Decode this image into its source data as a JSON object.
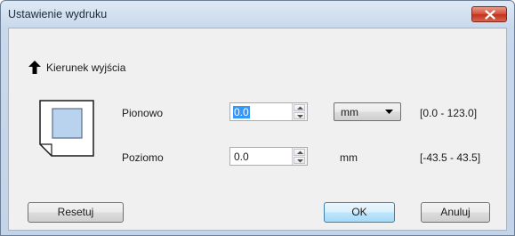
{
  "window": {
    "title": "Ustawienie wydruku"
  },
  "direction": {
    "label": "Kierunek wyjścia"
  },
  "vertical": {
    "label": "Pionowo",
    "value": "0.0",
    "unit": "mm",
    "range": "[0.0 - 123.0]"
  },
  "horizontal": {
    "label": "Poziomo",
    "value": "0.0",
    "unit": "mm",
    "range": "[-43.5 - 43.5]"
  },
  "buttons": {
    "reset": "Resetuj",
    "ok": "OK",
    "cancel": "Anuluj"
  },
  "icons": {
    "close": "close-icon",
    "arrow": "arrow-up-icon",
    "paper": "paper-icon"
  },
  "colors": {
    "close_button": "#d5503b",
    "selection": "#3399ff",
    "ok_border": "#3c7fb1"
  }
}
